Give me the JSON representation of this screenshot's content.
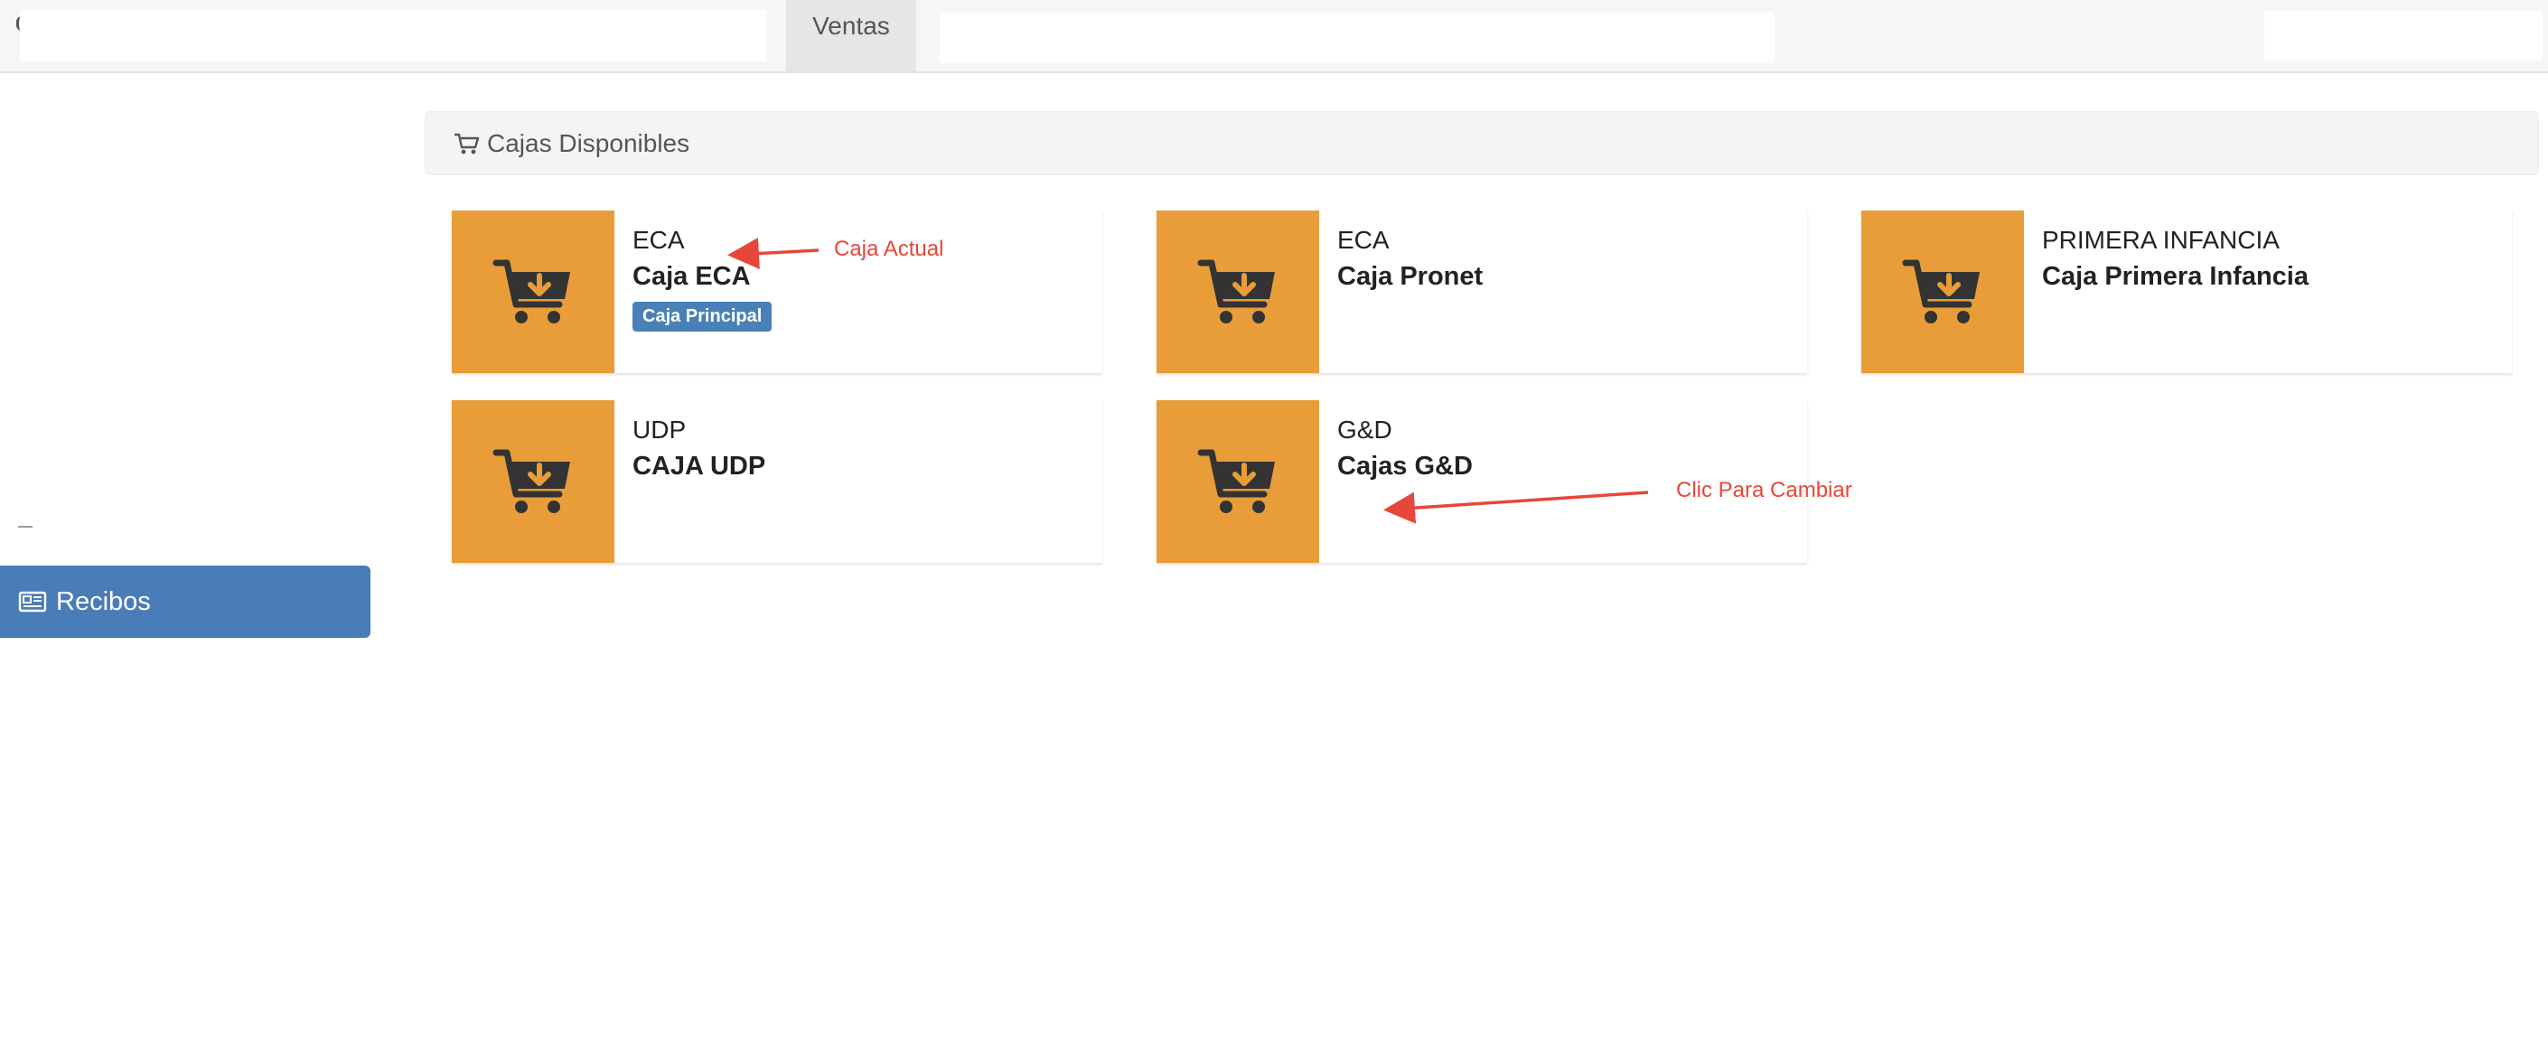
{
  "topbar": {
    "tab_label": "Ventas"
  },
  "sidebar": {
    "items": [
      {
        "label": "Recibos",
        "icon": "receipt-icon"
      }
    ]
  },
  "panel": {
    "title": "Cajas Disponibles",
    "icon": "cart-icon"
  },
  "boxes": [
    {
      "company": "ECA",
      "name": "Caja ECA",
      "badge": "Caja Principal",
      "icon": "cart-download-icon"
    },
    {
      "company": "ECA",
      "name": "Caja Pronet",
      "icon": "cart-download-icon"
    },
    {
      "company": "PRIMERA INFANCIA",
      "name": "Caja Primera Infancia",
      "icon": "cart-download-icon"
    },
    {
      "company": "UDP",
      "name": "CAJA UDP",
      "icon": "cart-download-icon"
    },
    {
      "company": "G&D",
      "name": "Cajas G&D",
      "icon": "cart-download-icon"
    }
  ],
  "annotations": {
    "current": "Caja Actual",
    "change": "Clic Para Cambiar"
  },
  "colors": {
    "box_icon_bg": "#e99d38",
    "accent_blue": "#4a7cb8",
    "annotation_red": "#e6473a"
  }
}
